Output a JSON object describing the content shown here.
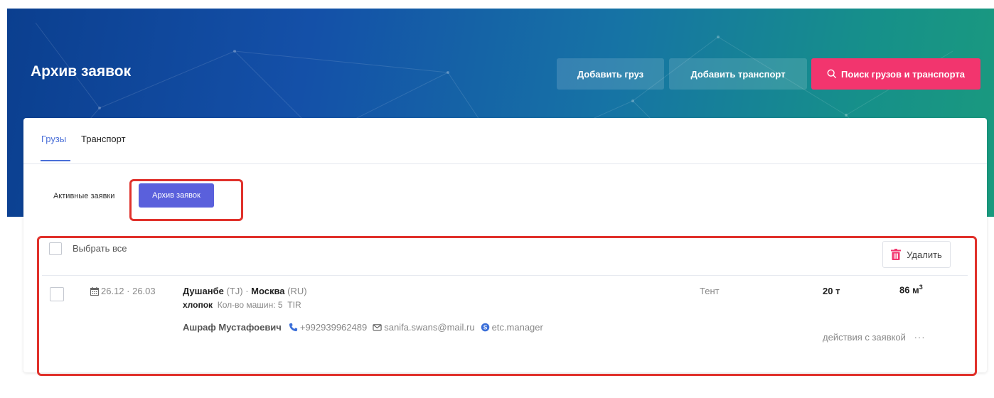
{
  "header": {
    "title": "Архив заявок",
    "add_cargo_label": "Добавить груз",
    "add_transport_label": "Добавить транспорт",
    "search_label": "Поиск грузов и транспорта",
    "search_icon": "search-icon"
  },
  "tabs": {
    "cargo": "Грузы",
    "transport": "Транспорт",
    "active": "cargo"
  },
  "subtabs": {
    "active_label": "Активные заявки",
    "archive_label": "Архив заявок",
    "selected": "archive"
  },
  "list": {
    "select_all_label": "Выбрать все",
    "delete_label": "Удалить",
    "rows": [
      {
        "dates": "26.12 · 26.03",
        "from_city": "Душанбе",
        "from_country": "(TJ)",
        "separator": "·",
        "to_city": "Москва",
        "to_country": "(RU)",
        "cargo_name": "хлопок",
        "vehicles_label": "Кол-во машин: 5",
        "permit": "TIR",
        "contact_name": "Ашраф Мустафоевич",
        "phone": "+992939962489",
        "email": "sanifa.swans@mail.ru",
        "skype": "etc.manager",
        "body_type": "Тент",
        "weight": "20 т",
        "volume": "86 м",
        "volume_sup": "3",
        "actions_label": "действия с заявкой",
        "actions_more": "···"
      }
    ]
  },
  "colors": {
    "primary": "#5a60dc",
    "accent": "#f2356e",
    "tab_active": "#4a6fd8",
    "highlight": "#e0312b"
  }
}
